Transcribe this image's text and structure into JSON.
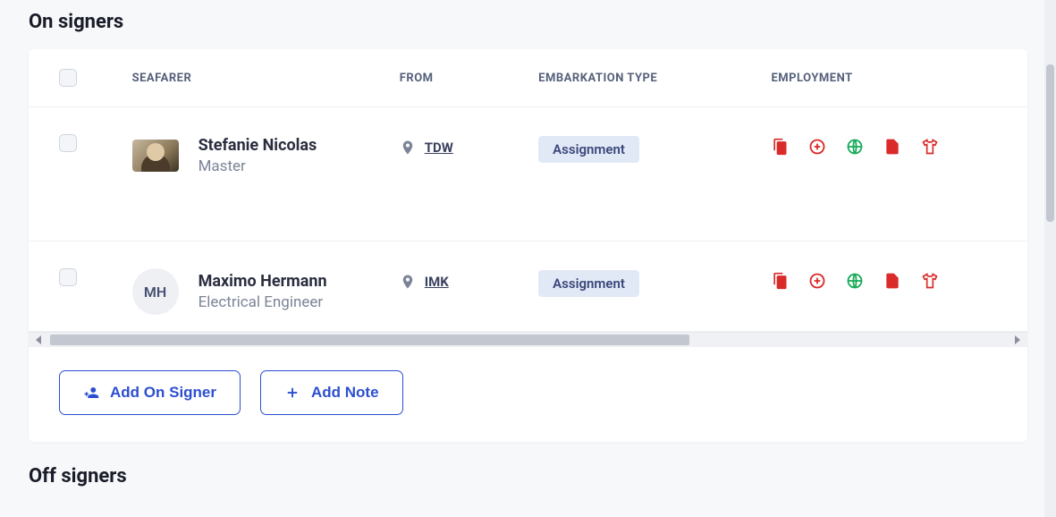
{
  "sections": {
    "on_signers_title": "On signers",
    "off_signers_title": "Off signers"
  },
  "table": {
    "headers": {
      "seafarer": "SEAFARER",
      "from": "FROM",
      "embark": "EMBARKATION TYPE",
      "employment": "EMPLOYMENT"
    },
    "rows": [
      {
        "name": "Stefanie Nicolas",
        "rank": "Master",
        "from_code": "TDW",
        "embark_type": "Assignment",
        "avatar_type": "photo",
        "initials": ""
      },
      {
        "name": "Maximo Hermann",
        "rank": "Electrical Engineer",
        "from_code": "IMK",
        "embark_type": "Assignment",
        "avatar_type": "initials",
        "initials": "MH"
      }
    ]
  },
  "buttons": {
    "add_on_signer": "Add On Signer",
    "add_note": "Add Note"
  },
  "employment_icons": [
    {
      "name": "documents-icon",
      "color": "red"
    },
    {
      "name": "medical-icon",
      "color": "redoutline"
    },
    {
      "name": "globe-icon",
      "color": "green"
    },
    {
      "name": "file-icon",
      "color": "red"
    },
    {
      "name": "shirt-icon",
      "color": "redoutline"
    }
  ]
}
